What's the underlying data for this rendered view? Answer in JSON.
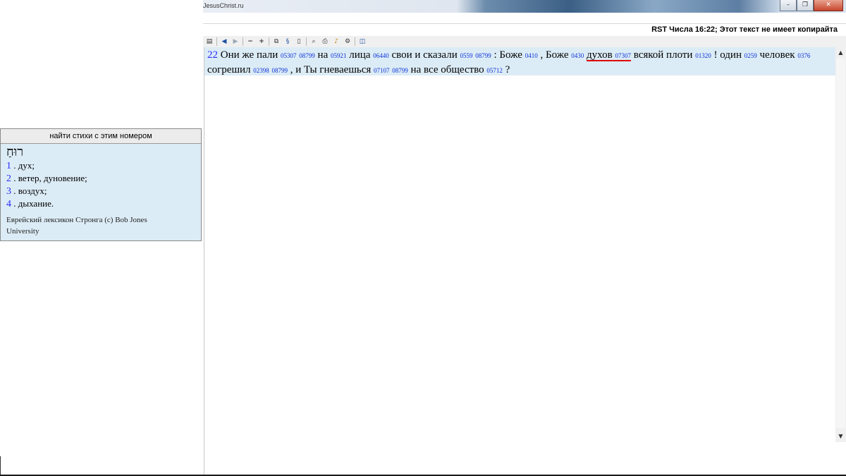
{
  "window": {
    "title": "JesusChrist.ru",
    "minimize": "–",
    "restore": "❐",
    "close": "✕"
  },
  "header": {
    "text": "RST Числа 16:22; Этот текст не имеет копирайта"
  },
  "toolbar": {
    "icons": [
      "panel-icon",
      "back-arrow-icon",
      "forward-arrow-icon",
      "zoom-out-icon",
      "zoom-in-icon",
      "copy-icon",
      "strongs-icon",
      "document-icon",
      "preview-icon",
      "print-icon",
      "audio-icon",
      "settings-icon",
      "layout-icon"
    ]
  },
  "verse": {
    "number": "22",
    "w1": "Они же пали",
    "s1": "05307",
    "s2": "08799",
    "w2": "на",
    "s3": "05921",
    "w3": "лица",
    "s4": "06440",
    "w4": "свои и сказали",
    "s5": "0559",
    "s6": "08799",
    "w5": ": Боже",
    "s7": "0410",
    "w6": ", Боже",
    "s8": "0430",
    "w7": "духов",
    "s9": "07307",
    "w8": "всякой плоти",
    "s10": "01320",
    "w9": "! один",
    "s11": "0259",
    "w10": "человек",
    "s12": "0376",
    "w11": "согрешил",
    "s13": "02398",
    "s14": "08799",
    "w12": ", и Ты гневаешься",
    "s15": "07107",
    "s16": "08799",
    "w13": "на все общество",
    "s17": "05712",
    "w14": "?"
  },
  "popup": {
    "header": "найти стихи с этим номером",
    "hebrew": "רוּחַ",
    "definitions": [
      {
        "num": "1",
        "text": ". дух;"
      },
      {
        "num": "2",
        "text": ". ветер, дуновение;"
      },
      {
        "num": "3",
        "text": ". воздух;"
      },
      {
        "num": "4",
        "text": ". дыхание."
      }
    ],
    "copyright": "Еврейский лексикон Стронга (c) Bob Jones University"
  },
  "scrollbar": {
    "up": "▲",
    "down": "▼"
  },
  "colors": {
    "verse_bg": "#dcecf6",
    "strong_link": "#0a2fd8",
    "underline": "#e00000"
  }
}
